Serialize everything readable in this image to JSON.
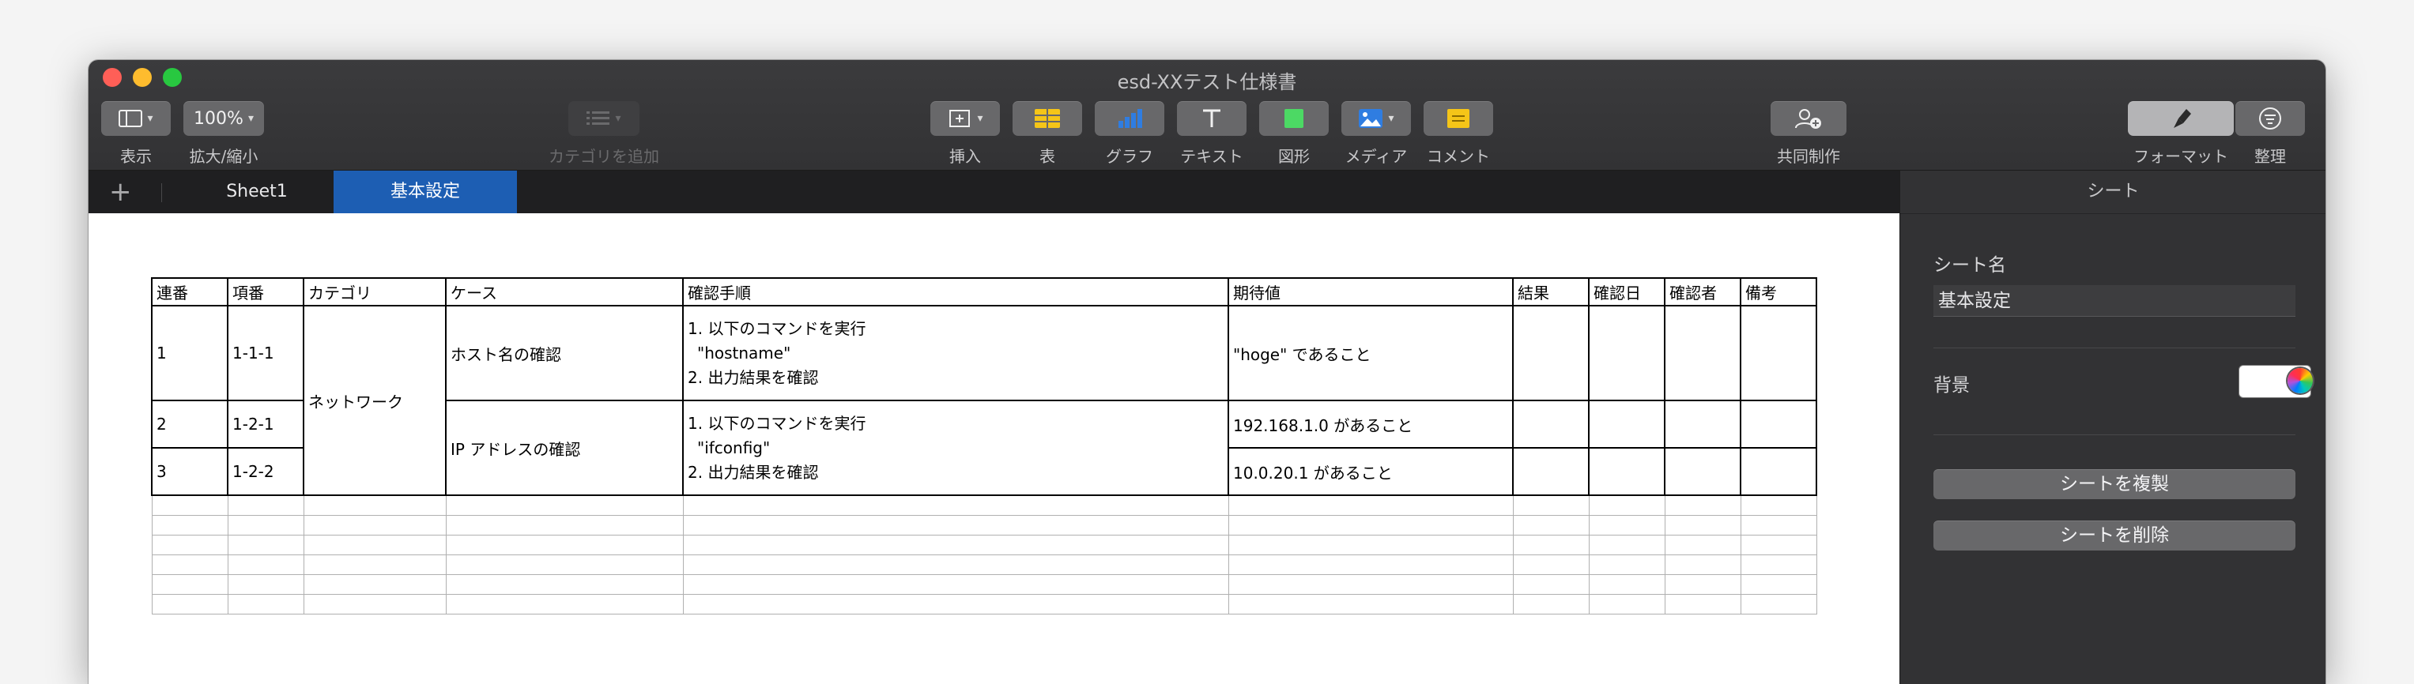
{
  "window": {
    "title": "esd-XXテスト仕様書"
  },
  "toolbar": {
    "view": {
      "label": "表示",
      "icon": "sidebar-view-icon"
    },
    "zoom": {
      "value": "100%",
      "label": "拡大/縮小"
    },
    "category": {
      "label": "カテゴリを追加",
      "icon": "list-icon"
    },
    "insert": {
      "label": "挿入",
      "icon": "insert-icon"
    },
    "table": {
      "label": "表",
      "icon": "table-icon",
      "color": "#f5c518"
    },
    "chart": {
      "label": "グラフ",
      "icon": "chart-icon",
      "color": "#2f7de1"
    },
    "text": {
      "label": "テキスト",
      "icon": "text-icon"
    },
    "shape": {
      "label": "図形",
      "icon": "shape-icon",
      "color": "#4cd964"
    },
    "media": {
      "label": "メディア",
      "icon": "media-icon",
      "color": "#2f7de1"
    },
    "comment": {
      "label": "コメント",
      "icon": "comment-icon",
      "color": "#f5c518"
    },
    "collab": {
      "label": "共同制作",
      "icon": "collaborate-icon"
    },
    "format": {
      "label": "フォーマット",
      "icon": "paintbrush-icon"
    },
    "organize": {
      "label": "整理",
      "icon": "filter-icon"
    }
  },
  "tabs": {
    "add_symbol": "+",
    "items": [
      {
        "label": "Sheet1",
        "active": false
      },
      {
        "label": "基本設定",
        "active": true
      }
    ]
  },
  "table": {
    "headers": [
      "連番",
      "項番",
      "カテゴリ",
      "ケース",
      "確認手順",
      "期待値",
      "結果",
      "確認日",
      "確認者",
      "備考"
    ],
    "rows": [
      {
        "no": "1",
        "item": "1-1-1",
        "category": "ネットワーク",
        "case": "ホスト名の確認",
        "steps": [
          "1. 以下のコマンドを実行",
          "\"hostname\"",
          "2. 出力結果を確認"
        ],
        "expected": "\"hoge\" であること"
      },
      {
        "no": "2",
        "item": "1-2-1",
        "case": "IP アドレスの確認",
        "steps": [
          "1. 以下のコマンドを実行",
          "\"ifconfig\"",
          "2. 出力結果を確認"
        ],
        "expected": "192.168.1.0 があること"
      },
      {
        "no": "3",
        "item": "1-2-2",
        "expected": "10.0.20.1 があること"
      }
    ]
  },
  "inspector": {
    "title": "シート",
    "sheet_name_label": "シート名",
    "sheet_name_value": "基本設定",
    "background_label": "背景",
    "background_color": "#ffffff",
    "duplicate_button": "シートを複製",
    "delete_button": "シートを削除"
  }
}
